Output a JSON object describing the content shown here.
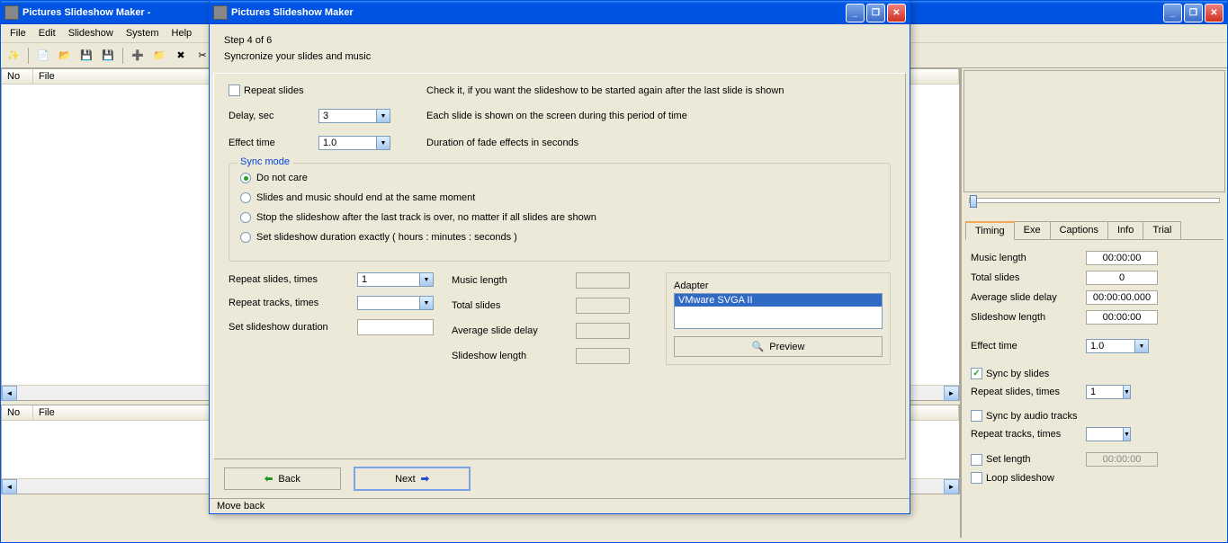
{
  "main_window": {
    "title": "Pictures Slideshow Maker -",
    "menu": [
      "File",
      "Edit",
      "Slideshow",
      "System",
      "Help"
    ],
    "list_cols": {
      "no": "No",
      "file": "File"
    }
  },
  "dialog": {
    "title": "Pictures Slideshow Maker",
    "step": "Step 4 of 6",
    "subtitle": "Syncronize your slides and music",
    "repeat_slides_label": "Repeat slides",
    "repeat_slides_desc": "Check it, if you want the slideshow to be started again after the last slide is shown",
    "delay_label": "Delay, sec",
    "delay_value": "3",
    "delay_desc": "Each slide is shown on the screen during this period of time",
    "effect_label": "Effect time",
    "effect_value": "1.0",
    "effect_desc": "Duration of fade effects in seconds",
    "sync_group": "Sync mode",
    "sync_options": [
      "Do not care",
      "Slides and music should end at the same moment",
      "Stop the slideshow after the last track is over, no matter if all slides are shown",
      "Set slideshow duration exactly  ( hours : minutes : seconds )"
    ],
    "sync_selected": 0,
    "repeat_slides_times_label": "Repeat slides, times",
    "repeat_slides_times_value": "1",
    "repeat_tracks_times_label": "Repeat tracks, times",
    "repeat_tracks_times_value": "",
    "set_duration_label": "Set slideshow duration",
    "music_length_label": "Music length",
    "total_slides_label": "Total slides",
    "avg_delay_label": "Average slide delay",
    "slideshow_length_label": "Slideshow length",
    "adapter_label": "Adapter",
    "adapter_item": "VMware SVGA II",
    "preview_btn": "Preview",
    "back_btn": "Back",
    "next_btn": "Next",
    "status": "Move back"
  },
  "right_panel": {
    "tabs": [
      "Timing",
      "Exe",
      "Captions",
      "Info",
      "Trial"
    ],
    "active_tab": 0,
    "music_length_label": "Music length",
    "music_length_value": "00:00:00",
    "total_slides_label": "Total slides",
    "total_slides_value": "0",
    "avg_delay_label": "Average slide delay",
    "avg_delay_value": "00:00:00.000",
    "slideshow_length_label": "Slideshow length",
    "slideshow_length_value": "00:00:00",
    "effect_time_label": "Effect time",
    "effect_time_value": "1.0",
    "sync_slides_label": "Sync by slides",
    "sync_slides_checked": true,
    "repeat_slides_label": "Repeat slides, times",
    "repeat_slides_value": "1",
    "sync_audio_label": "Sync by audio tracks",
    "sync_audio_checked": false,
    "repeat_tracks_label": "Repeat tracks, times",
    "repeat_tracks_value": "",
    "set_length_label": "Set length",
    "set_length_value": "00:00:00",
    "set_length_checked": false,
    "loop_label": "Loop slideshow",
    "loop_checked": false
  }
}
